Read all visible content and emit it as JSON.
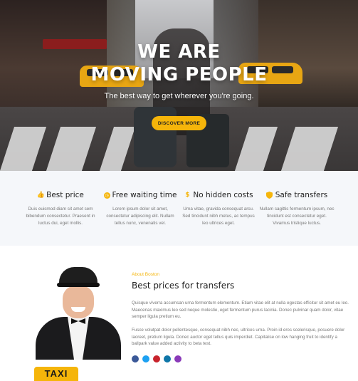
{
  "hero": {
    "title_line1": "WE ARE",
    "title_line2": "MOVING PEOPLE",
    "subtitle": "The best way to get wherever you're going.",
    "cta_label": "DISCOVER MORE"
  },
  "features": [
    {
      "icon": "thumbs-up-icon",
      "title": "Best price",
      "desc": "Duis euismod diam sit amet sem bibendum consectetur. Praesent in luctus dui, eget mollis."
    },
    {
      "icon": "clock-icon",
      "title": "Free waiting time",
      "desc": "Lorem ipsum dolor sit amet, consectetur adipiscing elit. Nullam tellus nunc, venenatis vel."
    },
    {
      "icon": "dollar-icon",
      "title": "No hidden costs",
      "desc": "Urna vitae, gravida consequat arcu. Sed tincidunt nibh metus, ac tempus leo ultrices eget."
    },
    {
      "icon": "shield-icon",
      "title": "Safe transfers",
      "desc": "Nullam sagittis fermentum ipsum, nec tincidunt est consectetur eget. Vivamus tristique luctus."
    }
  ],
  "about": {
    "tag": "About Boston",
    "title": "Best prices for transfers",
    "paragraph1": "Quisque viverra accumsan urna fermentum elementum. Etiam vitae elit at nulla egestas efficitur sit amet eu leo. Maecenas maximus leo sed neque molestie, eget fermentum purus lacinia. Donec pulvinar quam dolor, vitae semper ligula pretium eu.",
    "paragraph2": "Fusce volutpat dolor pellentesque, consequat nibh nec, ultrices urna. Proin id eros scelerisque, posuere dolor laoreet, pretium ligula. Donec auctor eget tellus quis imperdiet. Capitalise on low hanging fruit to identify a ballpark value added activity to beta test.",
    "sign_text": "TAXI",
    "social_colors": [
      "#3b5998",
      "#1da1f2",
      "#c8232c",
      "#0e76a8",
      "#8a3ab9"
    ]
  },
  "colors": {
    "accent": "#f5b50a"
  }
}
